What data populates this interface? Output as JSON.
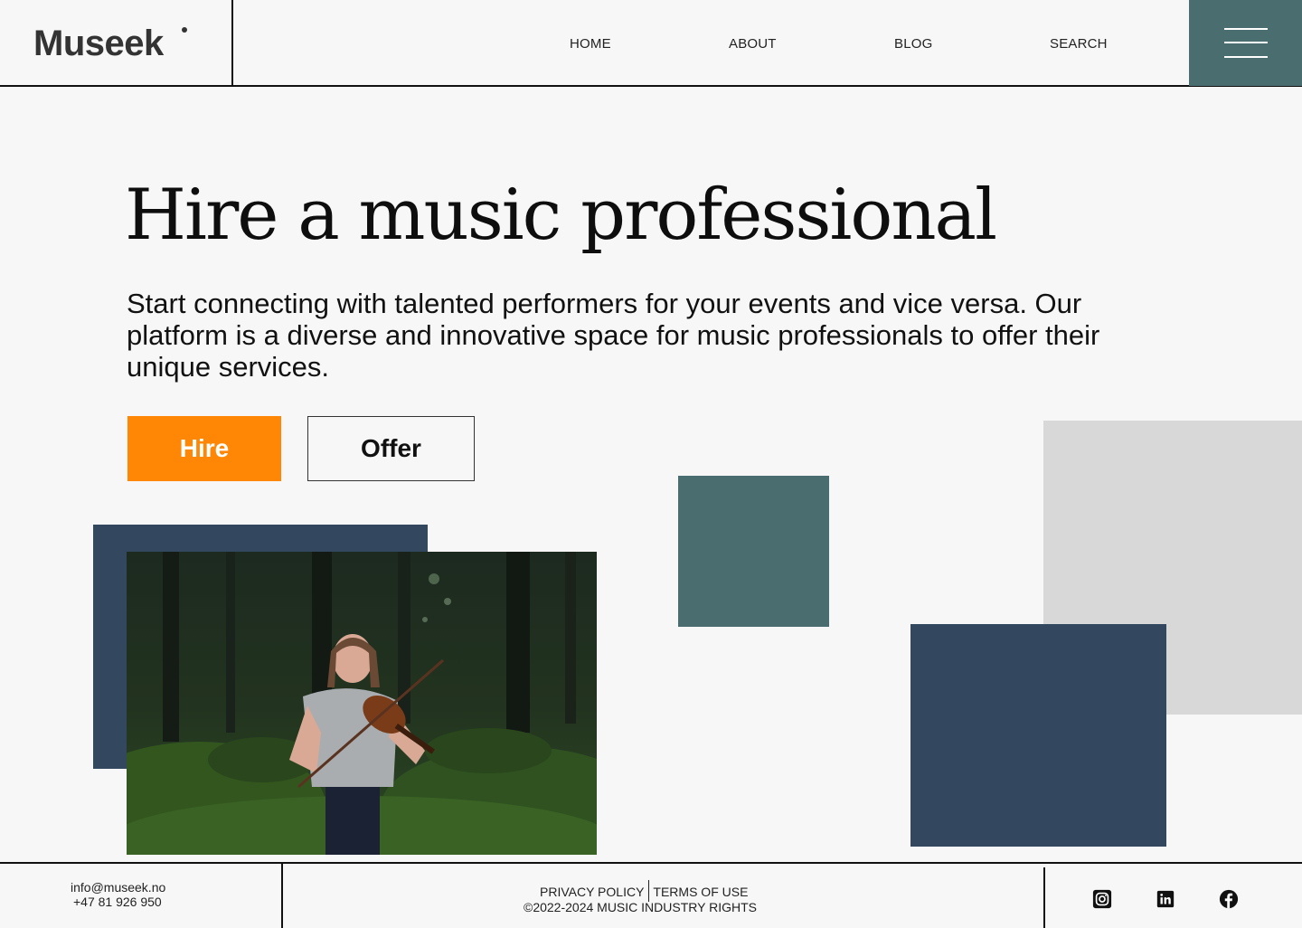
{
  "brand": {
    "logo": "Museek"
  },
  "nav": {
    "items": [
      "HOME",
      "ABOUT",
      "BLOG",
      "SEARCH"
    ]
  },
  "menu": {
    "icon": "hamburger-menu-icon"
  },
  "hero": {
    "title": "Hire a music professional",
    "subtitle": "Start connecting with talented performers for your events and vice versa. Our platform is a diverse and innovative space for music professionals to offer their unique services."
  },
  "actions": {
    "hire_label": "Hire",
    "offer_label": "Offer"
  },
  "photo": {
    "subject": "Woman playing violin in a fern forest"
  },
  "footer": {
    "email": "info@museek.no",
    "phone": "+47 81 926 950",
    "privacy": "PRIVACY POLICY",
    "terms": "TERMS OF USE",
    "copyright": "©2022-2024 MUSIC INDUSTRY RIGHTS",
    "social": [
      "instagram-icon",
      "linkedin-icon",
      "facebook-icon"
    ]
  },
  "colors": {
    "accent": "#ff8705",
    "teal": "#4a6e70",
    "navy": "#33485f",
    "gray": "#d8d8d8",
    "background": "#f7f7f7"
  }
}
